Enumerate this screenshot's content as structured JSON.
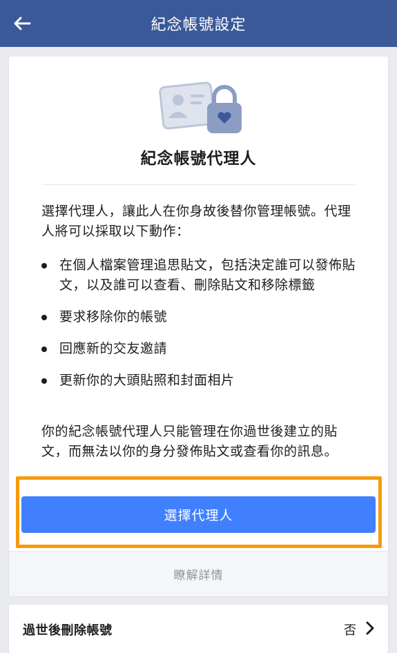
{
  "header": {
    "title": "紀念帳號設定",
    "back_icon": "back-arrow-icon",
    "background": "#3b5998"
  },
  "card": {
    "icon": "profile-card-lock-icon",
    "title": "紀念帳號代理人",
    "intro": "選擇代理人，讓此人在你身故後替你管理帳號。代理人將可以採取以下動作：",
    "bullets": [
      "在個人檔案管理追思貼文，包括決定誰可以發佈貼文，以及誰可以查看、刪除貼文和移除標籤",
      "要求移除你的帳號",
      "回應新的交友邀請",
      "更新你的大頭貼照和封面相片"
    ],
    "outro": "你的紀念帳號代理人只能管理在你過世後建立的貼文，而無法以你的身分發佈貼文或查看你的訊息。",
    "primary_button": "選擇代理人",
    "learn_more": "瞭解詳情",
    "button_color": "#4080ff",
    "highlight_color": "#f59c0b"
  },
  "delete_setting": {
    "label": "過世後刪除帳號",
    "value": "否",
    "chevron_icon": "chevron-right-icon"
  }
}
